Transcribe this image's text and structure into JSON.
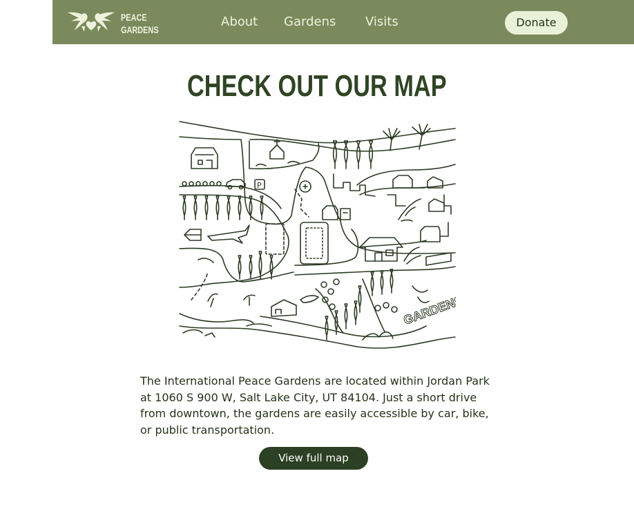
{
  "nav": {
    "logo_line1": "PEACE",
    "logo_line2": "GARDENS",
    "links": [
      {
        "label": "About"
      },
      {
        "label": "Gardens"
      },
      {
        "label": "Visits"
      }
    ],
    "donate_label": "Donate"
  },
  "main": {
    "title": "CHECK OUT OUR MAP",
    "map_gardens_label": "GARDENS",
    "map_parking_label": "P",
    "description": "The International Peace Gardens are located within Jordan Park at 1060 S 900 W, Salt Lake City, UT 84104. Just a short drive from downtown, the gardens are easily accessible by car, bike, or public transportation.",
    "cta_label": "View full map"
  },
  "colors": {
    "nav_bg": "#7b8a5c",
    "title": "#2f4424",
    "button_bg": "#2c4024",
    "donate_bg": "#e9f2d8",
    "map_line": "#2b3a22"
  },
  "icons": [
    "doves-heart-icon"
  ]
}
